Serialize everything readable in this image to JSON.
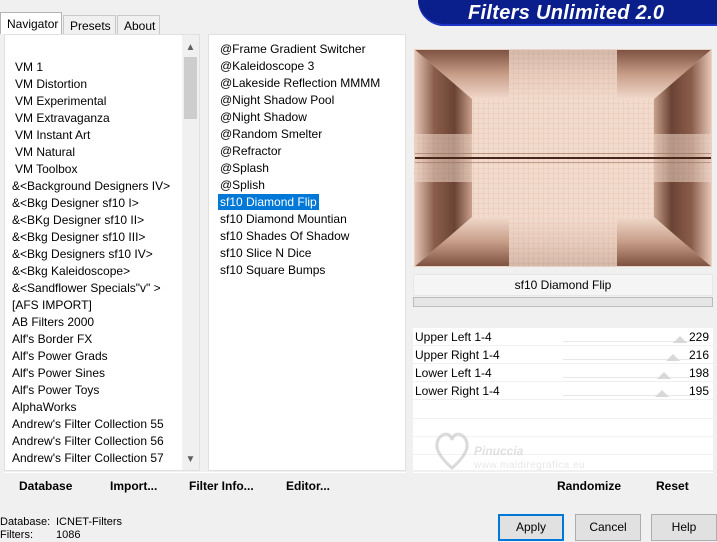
{
  "app_title": "Filters Unlimited 2.0",
  "tabs": [
    {
      "label": "Navigator",
      "active": true
    },
    {
      "label": "Presets",
      "active": false
    },
    {
      "label": "About",
      "active": false
    }
  ],
  "categories": [
    "VM 1",
    "VM Distortion",
    "VM Experimental",
    "VM Extravaganza",
    "VM Instant Art",
    "VM Natural",
    "VM Toolbox",
    "&<Background Designers IV>",
    "&<Bkg Designer sf10 I>",
    "&<BKg Designer sf10 II>",
    "&<Bkg Designer sf10 III>",
    "&<Bkg Designers sf10 IV>",
    "&<Bkg Kaleidoscope>",
    "&<Sandflower Specials\"v\" >",
    "[AFS IMPORT]",
    "AB Filters 2000",
    "Alf's Border FX",
    "Alf's Power Grads",
    "Alf's Power Sines",
    "Alf's Power Toys",
    "AlphaWorks",
    "Andrew's Filter Collection 55",
    "Andrew's Filter Collection 56",
    "Andrew's Filter Collection 57"
  ],
  "filters": [
    "@Frame Gradient Switcher",
    "@Kaleidoscope 3",
    "@Lakeside Reflection MMMM",
    "@Night Shadow Pool",
    "@Night Shadow",
    "@Random Smelter",
    "@Refractor",
    "@Splash",
    "@Splish",
    "sf10 Diamond Flip",
    "sf10 Diamond Mountian",
    "sf10 Shades Of Shadow",
    "sf10 Slice N Dice",
    "sf10 Square Bumps"
  ],
  "selected_filter_index": 9,
  "selected_filter_name": "sf10 Diamond Flip",
  "params": [
    {
      "label": "Upper Left 1-4",
      "value": 229
    },
    {
      "label": "Upper Right 1-4",
      "value": 216
    },
    {
      "label": "Lower Left 1-4",
      "value": 198
    },
    {
      "label": "Lower Right 1-4",
      "value": 195
    }
  ],
  "param_max": 255,
  "left_buttons": [
    "Database",
    "Import...",
    "Filter Info...",
    "Editor..."
  ],
  "right_buttons": [
    "Randomize",
    "Reset"
  ],
  "info": {
    "database_label": "Database:",
    "database_value": "ICNET-Filters",
    "filters_label": "Filters:",
    "filters_value": "1086"
  },
  "dialog_buttons": {
    "apply": "Apply",
    "cancel": "Cancel",
    "help": "Help"
  },
  "watermark": {
    "line1": "Pinuccia",
    "line2": "www.maidiregrafica.eu"
  },
  "icons": {
    "scroll_up": "▲",
    "scroll_down": "▼"
  },
  "colors": {
    "banner": "#0a1e8c",
    "selection": "#0078d7",
    "preview_light": "#f3dccd",
    "preview_dark": "#5a3528"
  }
}
